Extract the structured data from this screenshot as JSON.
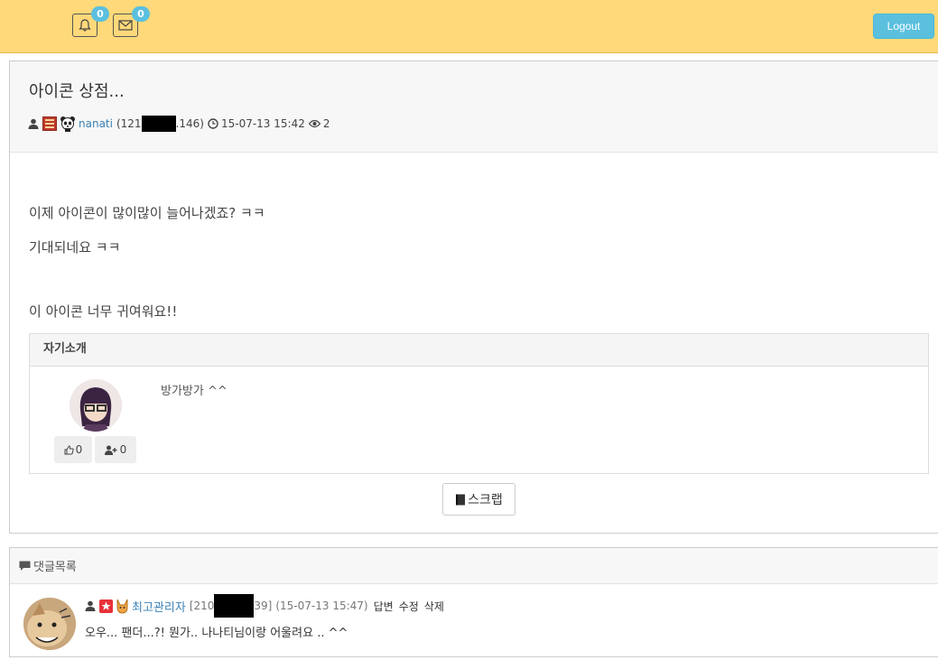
{
  "topbar": {
    "notifications_count": "0",
    "messages_count": "0",
    "logout_label": "Logout",
    "bg_color": "#ffd97a",
    "badge_color": "#5bc0de"
  },
  "post": {
    "title": "아이콘 상점...",
    "author": "nanati",
    "ip_prefix": "(121",
    "ip_suffix": ".146)",
    "datetime": "15-07-13 15:42",
    "views": "2",
    "lines": [
      "이제 아이콘이 많이많이 늘어나겠죠? ㅋㅋ",
      "기대되네요 ㅋㅋ",
      "이 아이콘 너무 귀여워요!!"
    ],
    "intro": {
      "heading": "자기소개",
      "text": "방가방가 ^^",
      "like_count": "0",
      "follow_count": "0"
    },
    "scrap_label": "스크랩"
  },
  "comments": {
    "heading": "댓글목록",
    "items": [
      {
        "author": "최고관리자",
        "ip_prefix": "[210",
        "ip_suffix": "39]",
        "datetime": "(15-07-13 15:47)",
        "reply_label": "답변",
        "edit_label": "수정",
        "delete_label": "삭제",
        "text": "오우... 팬더...?! 뭔가.. 나나티님이랑 어울려요 .. ^^"
      }
    ]
  },
  "icons": [
    "bell-icon",
    "envelope-icon",
    "user-icon",
    "level-icon",
    "panda-icon",
    "clock-icon",
    "eye-icon",
    "thumbs-up-icon",
    "user-plus-icon",
    "book-icon",
    "comment-icon",
    "admin-badge-icon",
    "fox-icon"
  ]
}
